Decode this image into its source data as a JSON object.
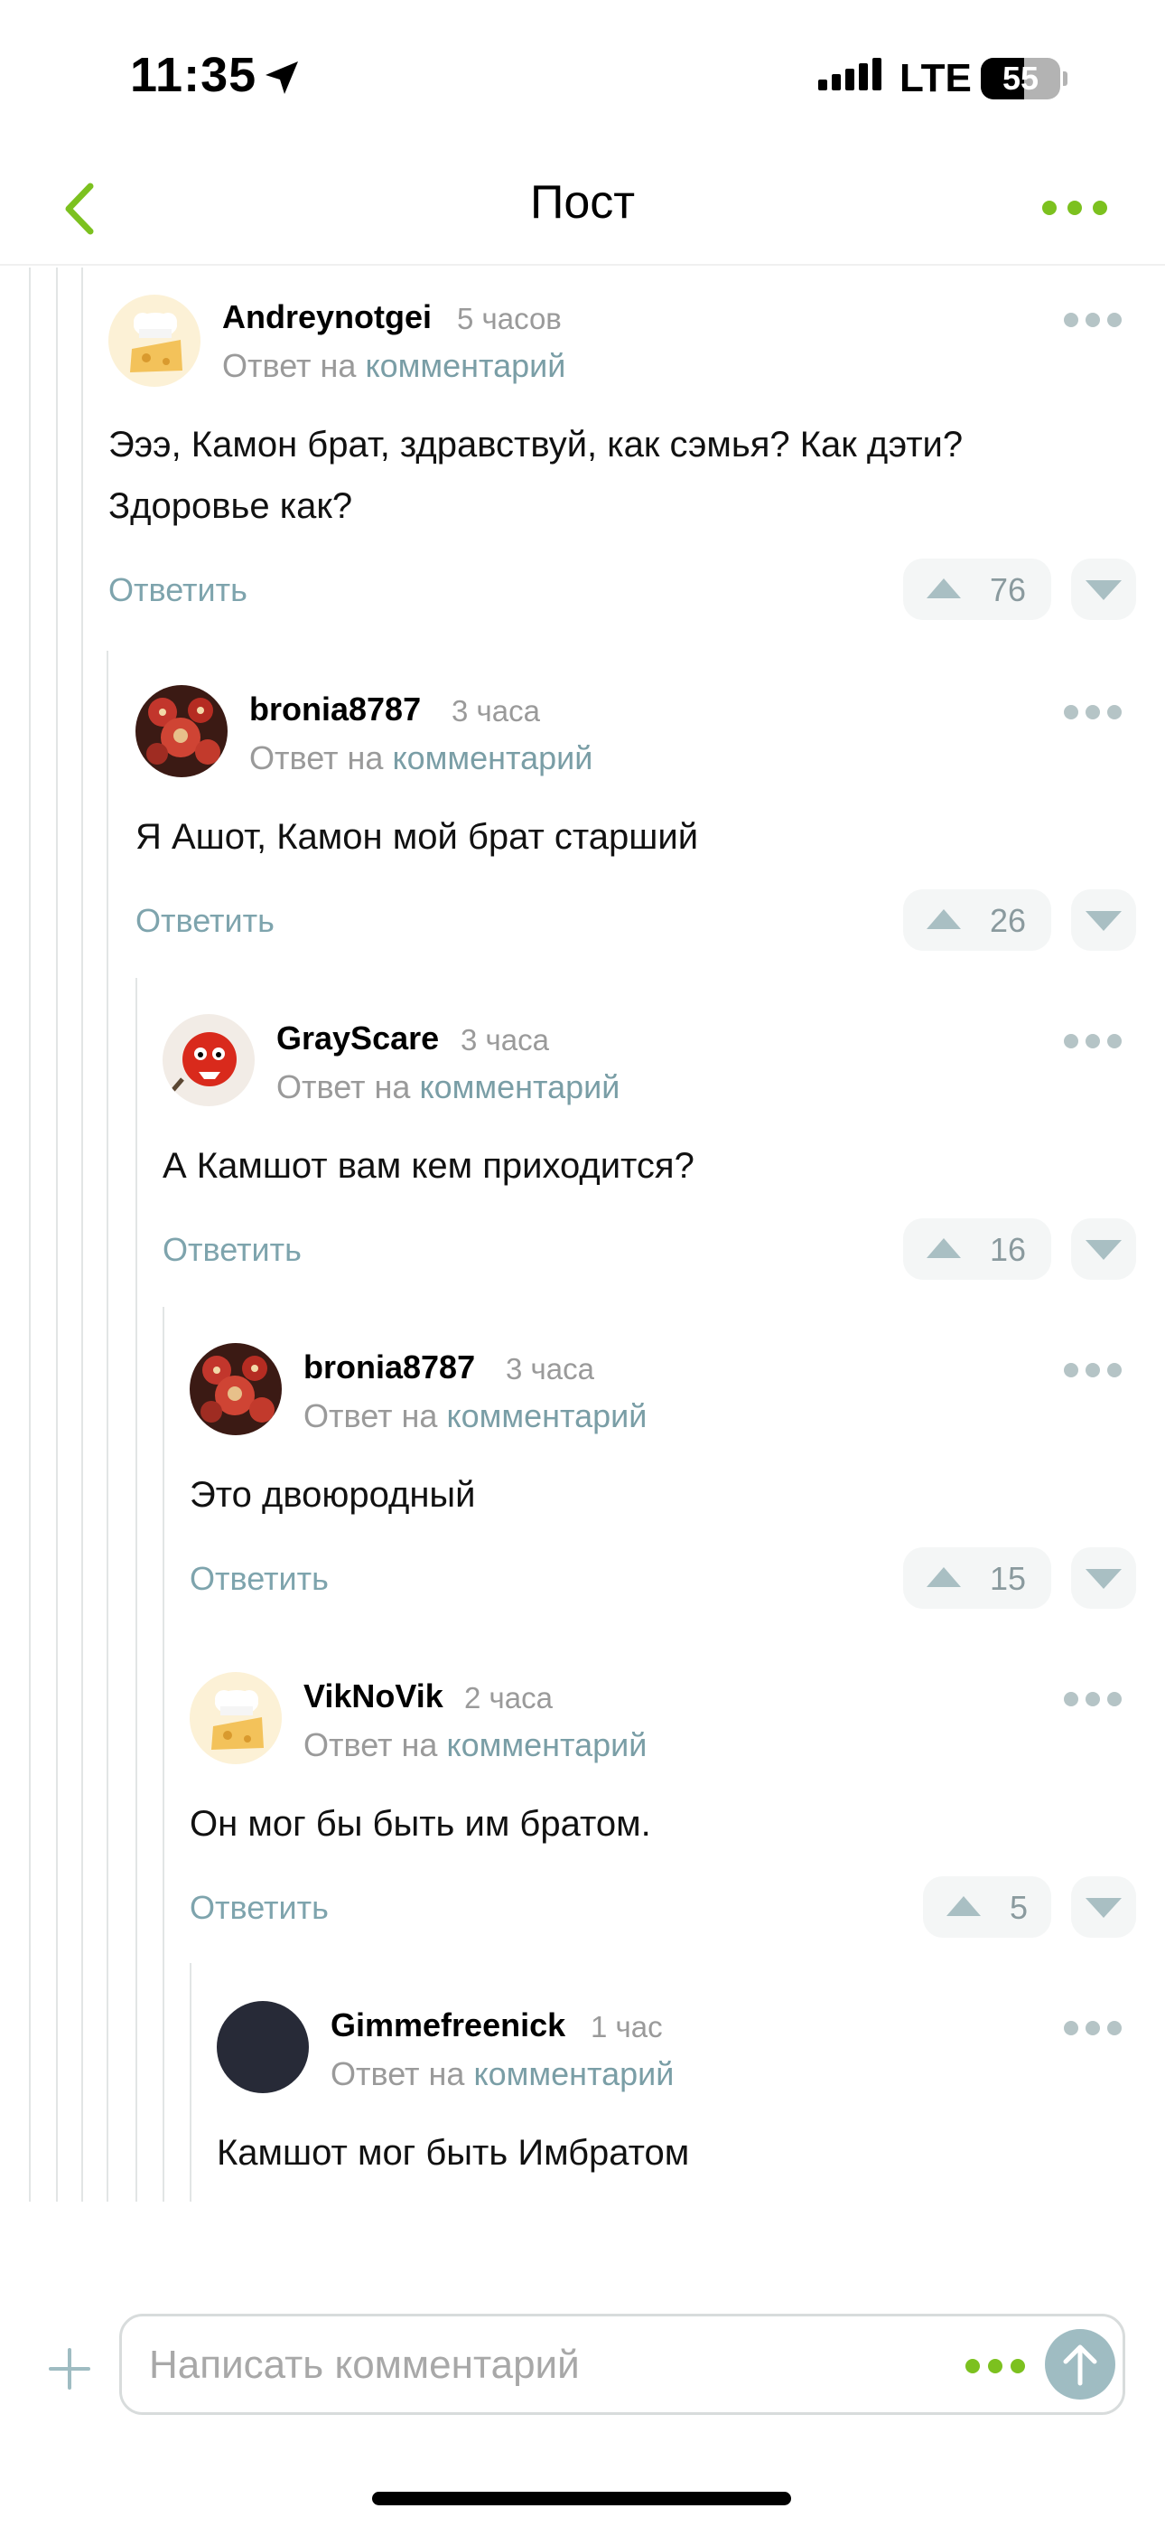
{
  "status_bar": {
    "time": "11:35",
    "network": "LTE",
    "battery_level": "55",
    "battery_fraction": 0.55,
    "icons": [
      "location-arrow-icon",
      "signal-bars-icon",
      "battery-icon"
    ]
  },
  "nav": {
    "title": "Пост",
    "back_icon": "chevron-left-icon",
    "more_icon": "more-dots-icon",
    "accent_color": "#7cc11f"
  },
  "comments": [
    {
      "username": "Andreynotgei",
      "time": "5 часов",
      "reply_prefix": "Ответ на",
      "reply_link": "комментарий",
      "text": "Эээ, Камон брат, здравствуй, как сэмья? Как дэти? Здоровье как?",
      "reply_label": "Ответить",
      "votes": "76",
      "avatar": "chef-cheese-avatar"
    },
    {
      "username": "bronia8787",
      "time": "3 часа",
      "reply_prefix": "Ответ на",
      "reply_link": "комментарий",
      "text": "Я Ашот, Камон мой брат старший",
      "reply_label": "Ответить",
      "votes": "26",
      "avatar": "red-art-avatar"
    },
    {
      "username": "GrayScare",
      "time": "3 часа",
      "reply_prefix": "Ответ на",
      "reply_link": "комментарий",
      "text": "А Камшот вам кем приходится?",
      "reply_label": "Ответить",
      "votes": "16",
      "avatar": "red-creature-avatar"
    },
    {
      "username": "bronia8787",
      "time": "3 часа",
      "reply_prefix": "Ответ на",
      "reply_link": "комментарий",
      "text": "Это двоюродный",
      "reply_label": "Ответить",
      "votes": "15",
      "avatar": "red-art-avatar"
    },
    {
      "username": "VikNoVik",
      "time": "2 часа",
      "reply_prefix": "Ответ на",
      "reply_link": "комментарий",
      "text": "Он мог бы быть им братом.",
      "reply_label": "Ответить",
      "votes": "5",
      "avatar": "chef-cheese-avatar"
    },
    {
      "username": "Gimmefreenick",
      "time": "1 час",
      "reply_prefix": "Ответ на",
      "reply_link": "комментарий",
      "text": "Камшот мог быть Имбратом",
      "avatar": "dark-circle-avatar"
    }
  ],
  "composer": {
    "placeholder": "Написать комментарий",
    "add_icon": "plus-icon",
    "send_icon": "arrow-up-icon"
  }
}
